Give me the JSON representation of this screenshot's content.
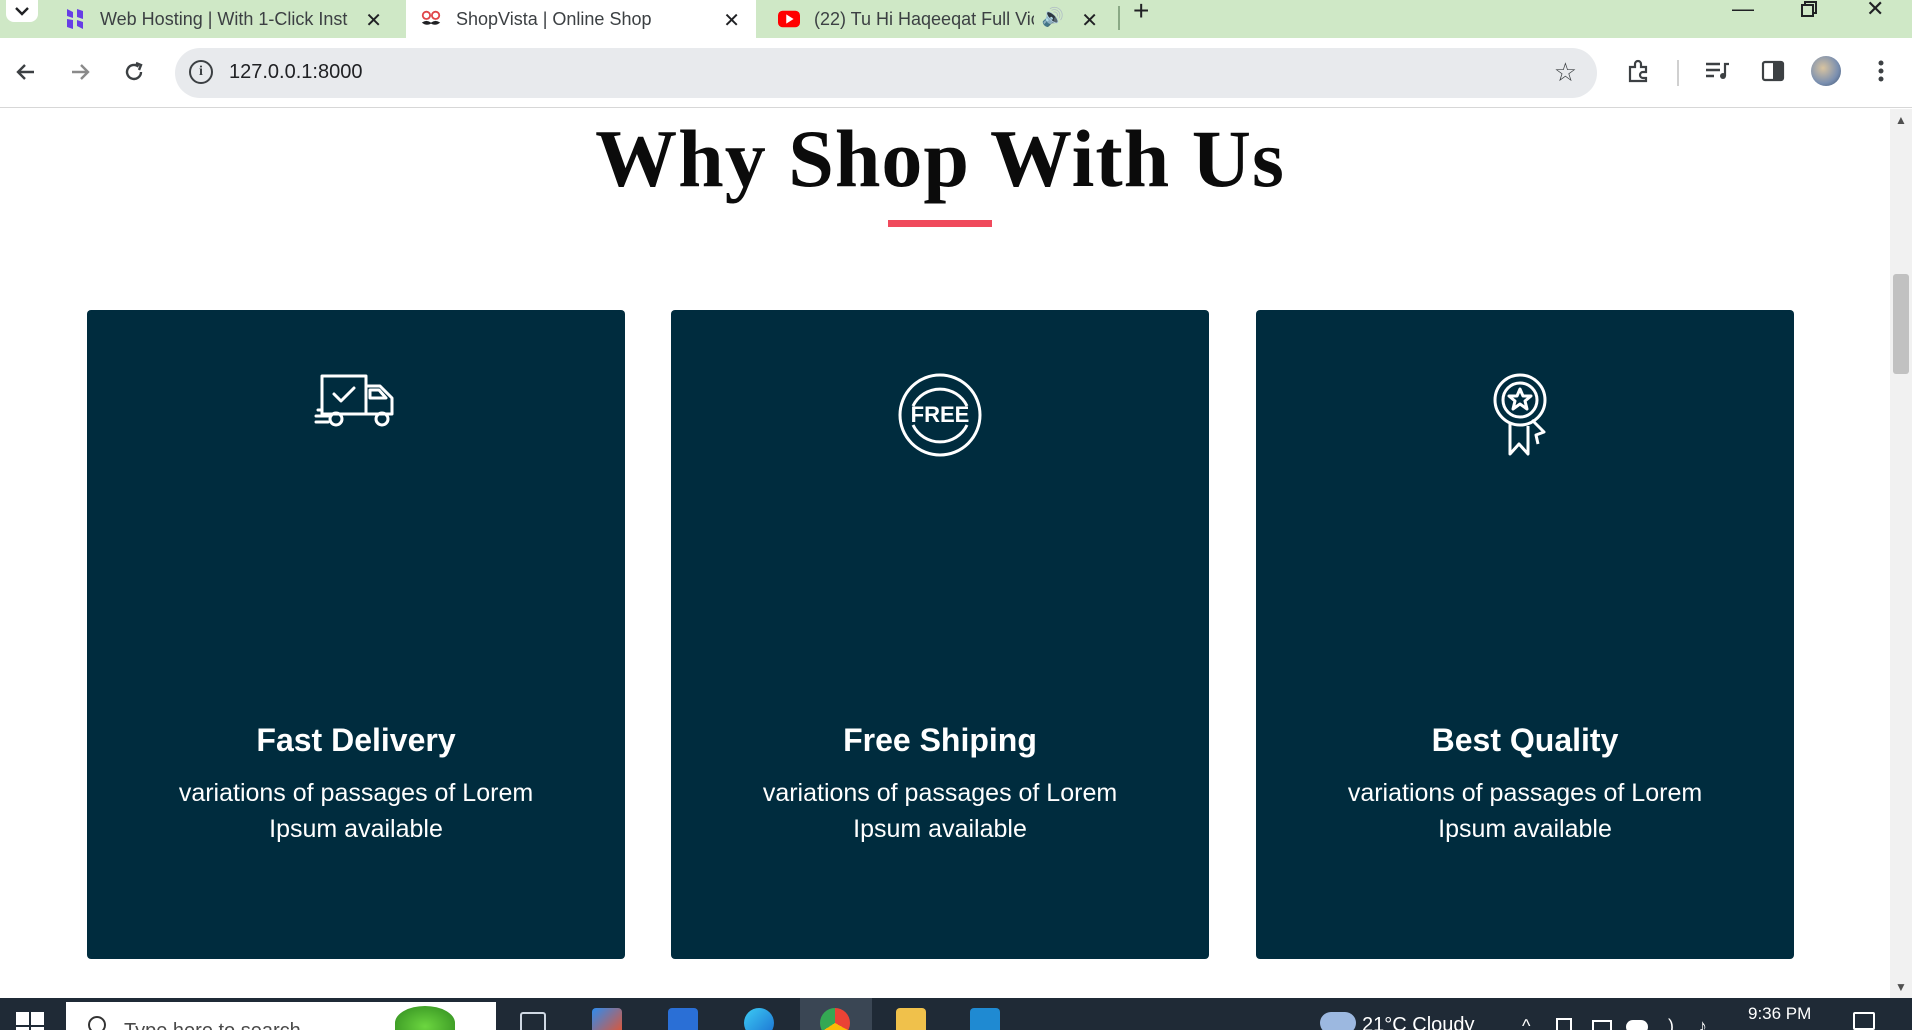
{
  "browser": {
    "tabs": [
      {
        "title": "Web Hosting | With 1-Click Inst",
        "favicon": "hostinger-icon",
        "active": false
      },
      {
        "title": "ShopVista | Online Shop",
        "favicon": "shop-mustache-icon",
        "active": true
      },
      {
        "title": "(22) Tu Hi Haqeeqat Full Vic",
        "favicon": "youtube-icon",
        "active": false,
        "audio": true
      }
    ],
    "new_tab_glyph": "+",
    "url": "127.0.0.1:8000"
  },
  "page": {
    "heading": "Why Shop With Us",
    "accent_color": "#f04a5c",
    "card_color": "#002c3e",
    "cards": [
      {
        "icon": "truck-icon",
        "title": "Fast Delivery",
        "text": "variations of passages of Lorem Ipsum available"
      },
      {
        "icon": "free-badge-icon",
        "title": "Free Shiping",
        "text": "variations of passages of Lorem Ipsum available"
      },
      {
        "icon": "award-ribbon-icon",
        "title": "Best Quality",
        "text": "variations of passages of Lorem Ipsum available"
      }
    ]
  },
  "taskbar": {
    "search_placeholder": "Type here to search",
    "weather": "21°C  Cloudy",
    "time": "9:36 PM"
  }
}
